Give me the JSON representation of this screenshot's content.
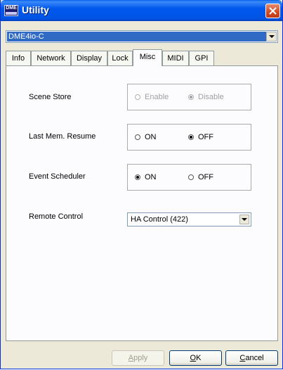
{
  "window": {
    "title": "Utility",
    "icon_text": "DME",
    "icon_name": "app-utility-icon",
    "close_icon": "close-icon"
  },
  "device": {
    "selected": "DME4io-C"
  },
  "tabs": [
    {
      "label": "Info",
      "active": false
    },
    {
      "label": "Network",
      "active": false
    },
    {
      "label": "Display",
      "active": false
    },
    {
      "label": "Lock",
      "active": false
    },
    {
      "label": "Misc",
      "active": true
    },
    {
      "label": "MIDI",
      "active": false
    },
    {
      "label": "GPI",
      "active": false
    }
  ],
  "misc": {
    "scene_store": {
      "label": "Scene Store",
      "enable_label": "Enable",
      "disable_label": "Disable",
      "value": "Disable",
      "enabled": false
    },
    "last_mem_resume": {
      "label": "Last Mem. Resume",
      "on_label": "ON",
      "off_label": "OFF",
      "value": "OFF"
    },
    "event_scheduler": {
      "label": "Event Scheduler",
      "on_label": "ON",
      "off_label": "OFF",
      "value": "ON"
    },
    "remote_control": {
      "label": "Remote Control",
      "selected": "HA Control (422)"
    }
  },
  "buttons": {
    "apply": {
      "accel": "A",
      "rest": "pply",
      "enabled": false
    },
    "ok": {
      "accel": "O",
      "rest": "K",
      "enabled": true
    },
    "cancel": {
      "accel": "C",
      "rest": "ancel",
      "enabled": true
    }
  },
  "colors": {
    "titlebar": "#0054e3",
    "selection": "#316ac5",
    "close": "#d24b23",
    "dialog_bg": "#ece9d8"
  }
}
